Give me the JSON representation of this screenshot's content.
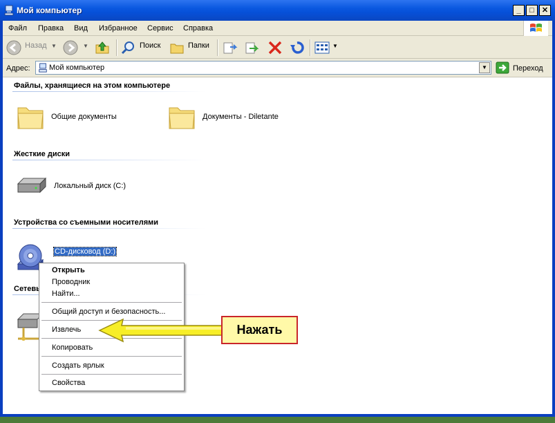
{
  "window": {
    "title": "Мой компьютер"
  },
  "menu": [
    "Файл",
    "Правка",
    "Вид",
    "Избранное",
    "Сервис",
    "Справка"
  ],
  "toolbar": {
    "back": "Назад",
    "search": "Поиск",
    "folders": "Папки"
  },
  "address": {
    "label": "Адрес:",
    "value": "Мой компьютер",
    "go": "Переход"
  },
  "groups": {
    "files": {
      "title": "Файлы, хранящиеся на этом компьютере",
      "items": [
        "Общие документы",
        "Документы - Diletante"
      ]
    },
    "drives": {
      "title": "Жесткие диски",
      "items": [
        "Локальный диск (C:)"
      ]
    },
    "removable": {
      "title": "Устройства со съемными носителями",
      "items": [
        "CD-дисковод (D:)"
      ]
    },
    "network": {
      "title": "Сетевы"
    }
  },
  "context_menu": {
    "items": [
      "Открыть",
      "Проводник",
      "Найти...",
      "Общий доступ и безопасность...",
      "Извлечь",
      "Копировать",
      "Создать ярлык",
      "Свойства"
    ]
  },
  "hint": {
    "label": "Нажать"
  },
  "colors": {
    "titlebar": "#0a58e0",
    "selection": "#316ac5",
    "hint_border": "#c9252a",
    "hint_fill": "#fff9a8",
    "arrow": "#f7ee27"
  }
}
